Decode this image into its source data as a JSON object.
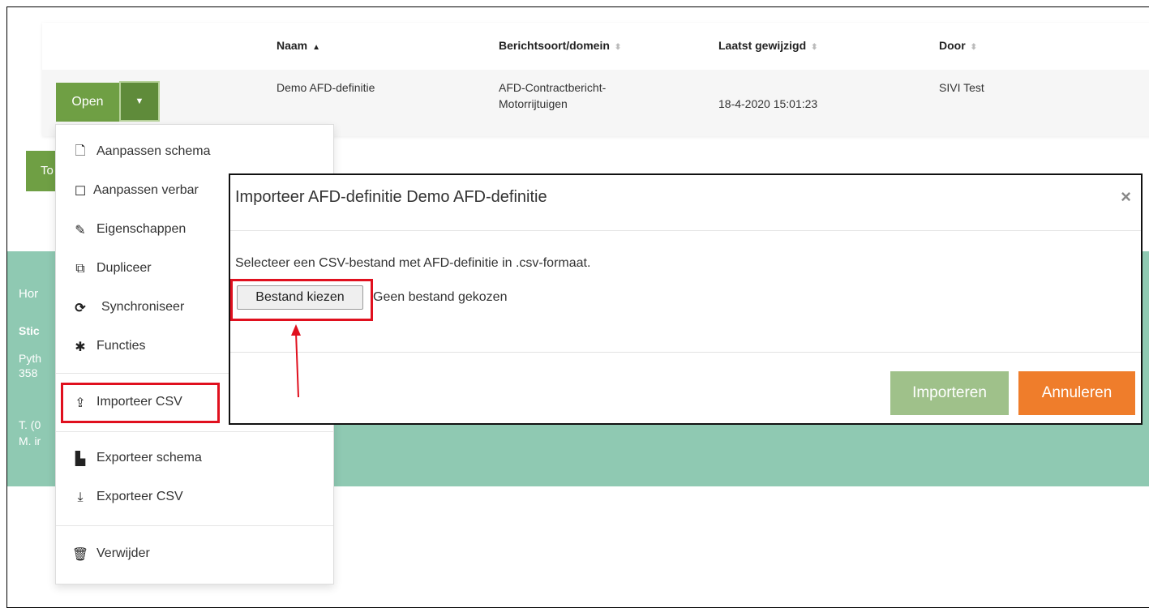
{
  "table": {
    "headers": [
      {
        "label": "Naam",
        "sort": "▲"
      },
      {
        "label": "Berichtsoort/domein",
        "sort": "⬍"
      },
      {
        "label": "Laatst gewijzigd",
        "sort": "⬍"
      },
      {
        "label": "Door",
        "sort": "⬍"
      }
    ],
    "row": {
      "naam": "Demo AFD-definitie",
      "domein_line1": "AFD-Contractbericht-",
      "domein_line2": "Motorrijtuigen",
      "gewijzigd": "18-4-2020 15:01:23",
      "door": "SIVI Test"
    },
    "open_label": "Open",
    "caret": "▼"
  },
  "behind_button_label": "To",
  "footer": {
    "line1": "Hor",
    "line2": "Stic",
    "line3": "Pyth",
    "line4": "358",
    "line5": "T. (0",
    "line6": "M. ir"
  },
  "dropdown": {
    "items": [
      {
        "icon": "file-icon",
        "glyph": "🗋",
        "label": "Aanpassen schema"
      },
      {
        "icon": "square-icon",
        "glyph": "☐",
        "label": "Aanpassen verbar"
      },
      {
        "icon": "edit-icon",
        "glyph": "✎",
        "label": "Eigenschappen"
      },
      {
        "icon": "copy-icon",
        "glyph": "⧉",
        "label": "Dupliceer"
      },
      {
        "icon": "sync-icon",
        "glyph": "⟳",
        "label": "Synchroniseer"
      },
      {
        "icon": "gear-icon",
        "glyph": "✱",
        "label": "Functies"
      },
      {
        "icon": "upload-icon",
        "glyph": "⇪",
        "label": "Importeer CSV"
      },
      {
        "icon": "file-zip-icon",
        "glyph": "▙",
        "label": "Exporteer schema"
      },
      {
        "icon": "download-icon",
        "glyph": "⤓",
        "label": "Exporteer CSV"
      },
      {
        "icon": "trash-icon",
        "glyph": "🗑",
        "label": "Verwijder"
      }
    ]
  },
  "modal": {
    "title": "Importeer AFD-definitie Demo AFD-definitie",
    "close": "×",
    "description": "Selecteer een CSV-bestand met AFD-definitie in .csv-formaat.",
    "file_button": "Bestand kiezen",
    "file_status": "Geen bestand gekozen",
    "import_label": "Importeren",
    "cancel_label": "Annuleren"
  },
  "colors": {
    "green": "#6f9f44",
    "teal": "#8fc9b2",
    "orange": "#ef7d2b",
    "highlight": "#e0101e"
  }
}
